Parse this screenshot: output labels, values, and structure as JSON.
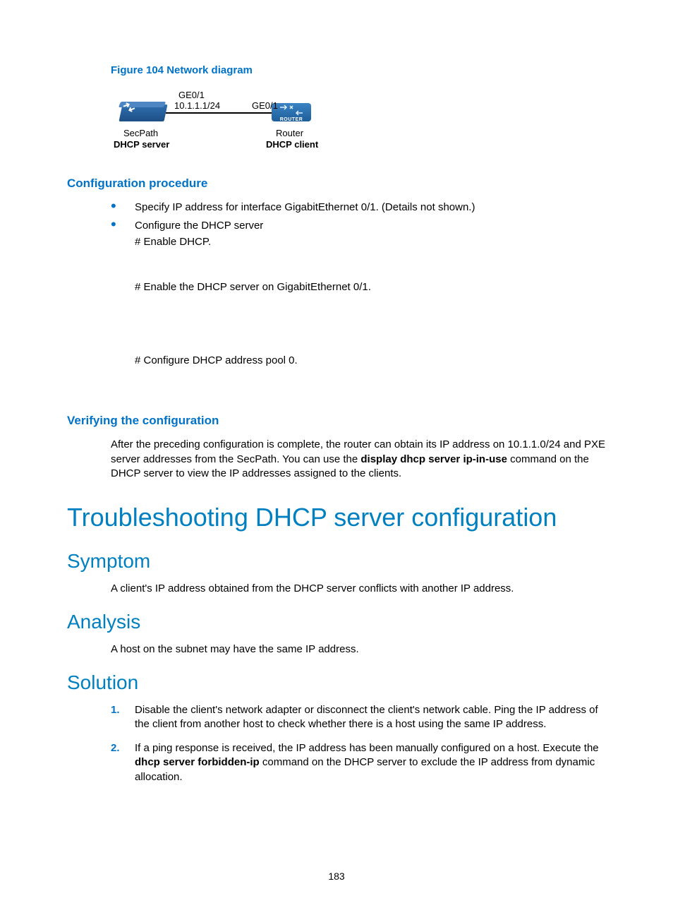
{
  "figure": {
    "caption": "Figure 104 Network diagram",
    "left_if": "GE0/1",
    "left_ip": "10.1.1.1/24",
    "right_if": "GE0/1",
    "left_name": "SecPath",
    "left_role": "DHCP server",
    "right_name": "Router",
    "right_role": "DHCP client",
    "router_badge": "ROUTER"
  },
  "sections": {
    "config_procedure": "Configuration procedure",
    "bullets": [
      "Specify IP address for interface GigabitEthernet 0/1. (Details not shown.)",
      "Configure the DHCP server"
    ],
    "steps": [
      "# Enable DHCP.",
      "# Enable the DHCP server on GigabitEthernet 0/1.",
      "# Configure DHCP address pool 0."
    ],
    "verify_heading": "Verifying the configuration",
    "verify_para_1": "After the preceding configuration is complete, the router can obtain its IP address on 10.1.1.0/24 and PXE server addresses from the SecPath. You can use the ",
    "verify_cmd": "display dhcp server ip-in-use",
    "verify_para_2": " command on the DHCP server to view the IP addresses assigned to the clients."
  },
  "troubleshoot": {
    "title": "Troubleshooting DHCP server configuration",
    "symptom_h": "Symptom",
    "symptom": "A client's IP address obtained from the DHCP server conflicts with another IP address.",
    "analysis_h": "Analysis",
    "analysis": "A host on the subnet may have the same IP address.",
    "solution_h": "Solution",
    "solutions": [
      "Disable the client's network adapter or disconnect the client's network cable. Ping the IP address of the client from another host to check whether there is a host using the same IP address.",
      "If a ping response is received, the IP address has been manually configured on a host. Execute the "
    ],
    "solution2_cmd": "dhcp server forbidden-ip",
    "solution2_tail": " command on the DHCP server to exclude the IP address from dynamic allocation."
  },
  "page_number": "183"
}
